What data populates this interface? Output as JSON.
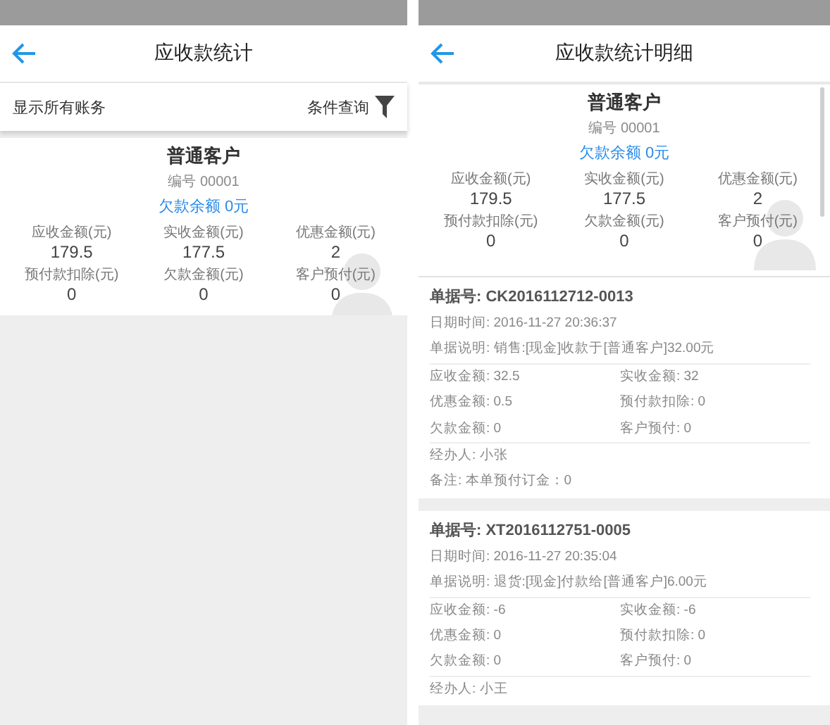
{
  "screens": [
    {
      "header": {
        "title": "应收款统计"
      },
      "filter_bar": {
        "label": "显示所有账务",
        "query": "条件查询"
      },
      "customer": {
        "name": "普通客户",
        "code": "编号 00001",
        "balance": "欠款余额  0元",
        "stats": [
          {
            "label": "应收金额(元)",
            "value": "179.5"
          },
          {
            "label": "实收金额(元)",
            "value": "177.5"
          },
          {
            "label": "优惠金额(元)",
            "value": "2"
          },
          {
            "label": "预付款扣除(元)",
            "value": "0"
          },
          {
            "label": "欠款金额(元)",
            "value": "0"
          },
          {
            "label": "客户预付(元)",
            "value": "0"
          }
        ]
      }
    },
    {
      "header": {
        "title": "应收款统计明细"
      },
      "customer": {
        "name": "普通客户",
        "code": "编号 00001",
        "balance": "欠款余额  0元",
        "stats": [
          {
            "label": "应收金额(元)",
            "value": "179.5"
          },
          {
            "label": "实收金额(元)",
            "value": "177.5"
          },
          {
            "label": "优惠金额(元)",
            "value": "2"
          },
          {
            "label": "预付款扣除(元)",
            "value": "0"
          },
          {
            "label": "欠款金额(元)",
            "value": "0"
          },
          {
            "label": "客户预付(元)",
            "value": "0"
          }
        ]
      },
      "documents": [
        {
          "number": "单据号: CK2016112712-0013",
          "date": "日期时间: 2016-11-27 20:36:37",
          "description": "单据说明: 销售:[现金]收款于[普通客户]32.00元",
          "amounts": [
            "应收金额: 32.5",
            "实收金额: 32",
            "优惠金额: 0.5",
            "预付款扣除:  0",
            "欠款金额: 0",
            "客户预付: 0"
          ],
          "handler": "经办人: 小张",
          "note": "备注: 本单预付订金：0"
        },
        {
          "number": "单据号: XT2016112751-0005",
          "date": "日期时间: 2016-11-27 20:35:04",
          "description": "单据说明: 退货:[现金]付款给[普通客户]6.00元",
          "amounts": [
            "应收金额: -6",
            "实收金额: -6",
            "优惠金额: 0",
            "预付款扣除:  0",
            "欠款金额: 0",
            "客户预付: 0"
          ],
          "handler": "经办人: 小王"
        }
      ]
    }
  ]
}
